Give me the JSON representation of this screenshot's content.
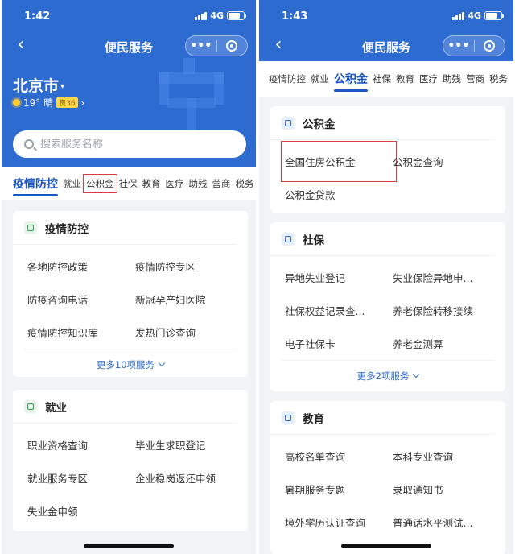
{
  "left": {
    "status": {
      "time": "1:42",
      "network": "4G"
    },
    "nav": {
      "title": "便民服务",
      "back_icon": "‹",
      "more_icon": "•••"
    },
    "location": {
      "city": "北京市",
      "city_arrow": "▾"
    },
    "weather": {
      "temp": "19° 晴",
      "aqi": "良36",
      "arrow": "›"
    },
    "search": {
      "placeholder": "搜索服务名称"
    },
    "tabs": [
      "疫情防控",
      "就业",
      "公积金",
      "社保",
      "教育",
      "医疗",
      "助残",
      "营商",
      "税务"
    ],
    "cards": [
      {
        "title": "疫情防控",
        "items": [
          "各地防控政策",
          "疫情防控专区",
          "防疫咨询电话",
          "新冠孕产妇医院",
          "疫情防控知识库",
          "发热门诊查询"
        ],
        "more": "更多10项服务"
      },
      {
        "title": "就业",
        "items": [
          "职业资格查询",
          "毕业生求职登记",
          "就业服务专区",
          "企业稳岗返还申领",
          "失业金申领"
        ]
      }
    ]
  },
  "right": {
    "status": {
      "time": "1:43",
      "network": "4G"
    },
    "nav": {
      "title": "便民服务",
      "back_icon": "‹",
      "more_icon": "•••"
    },
    "tabs": [
      "疫情防控",
      "就业",
      "公积金",
      "社保",
      "教育",
      "医疗",
      "助残",
      "营商",
      "税务"
    ],
    "cards": [
      {
        "title": "公积金",
        "items": [
          "全国住房公积金",
          "公积金查询",
          "公积金贷款"
        ]
      },
      {
        "title": "社保",
        "items": [
          "异地失业登记",
          "失业保险异地申...",
          "社保权益记录查...",
          "养老保险转移接续",
          "电子社保卡",
          "养老金测算"
        ],
        "more": "更多2项服务"
      },
      {
        "title": "教育",
        "items": [
          "高校名单查询",
          "本科专业查询",
          "暑期服务专题",
          "录取通知书",
          "境外学历认证查询",
          "普通话水平测试..."
        ]
      }
    ]
  },
  "colors": {
    "brand_blue": "#2d6bd1",
    "highlight_red": "#d83c3c",
    "bg_gray": "#f2f3f5"
  }
}
